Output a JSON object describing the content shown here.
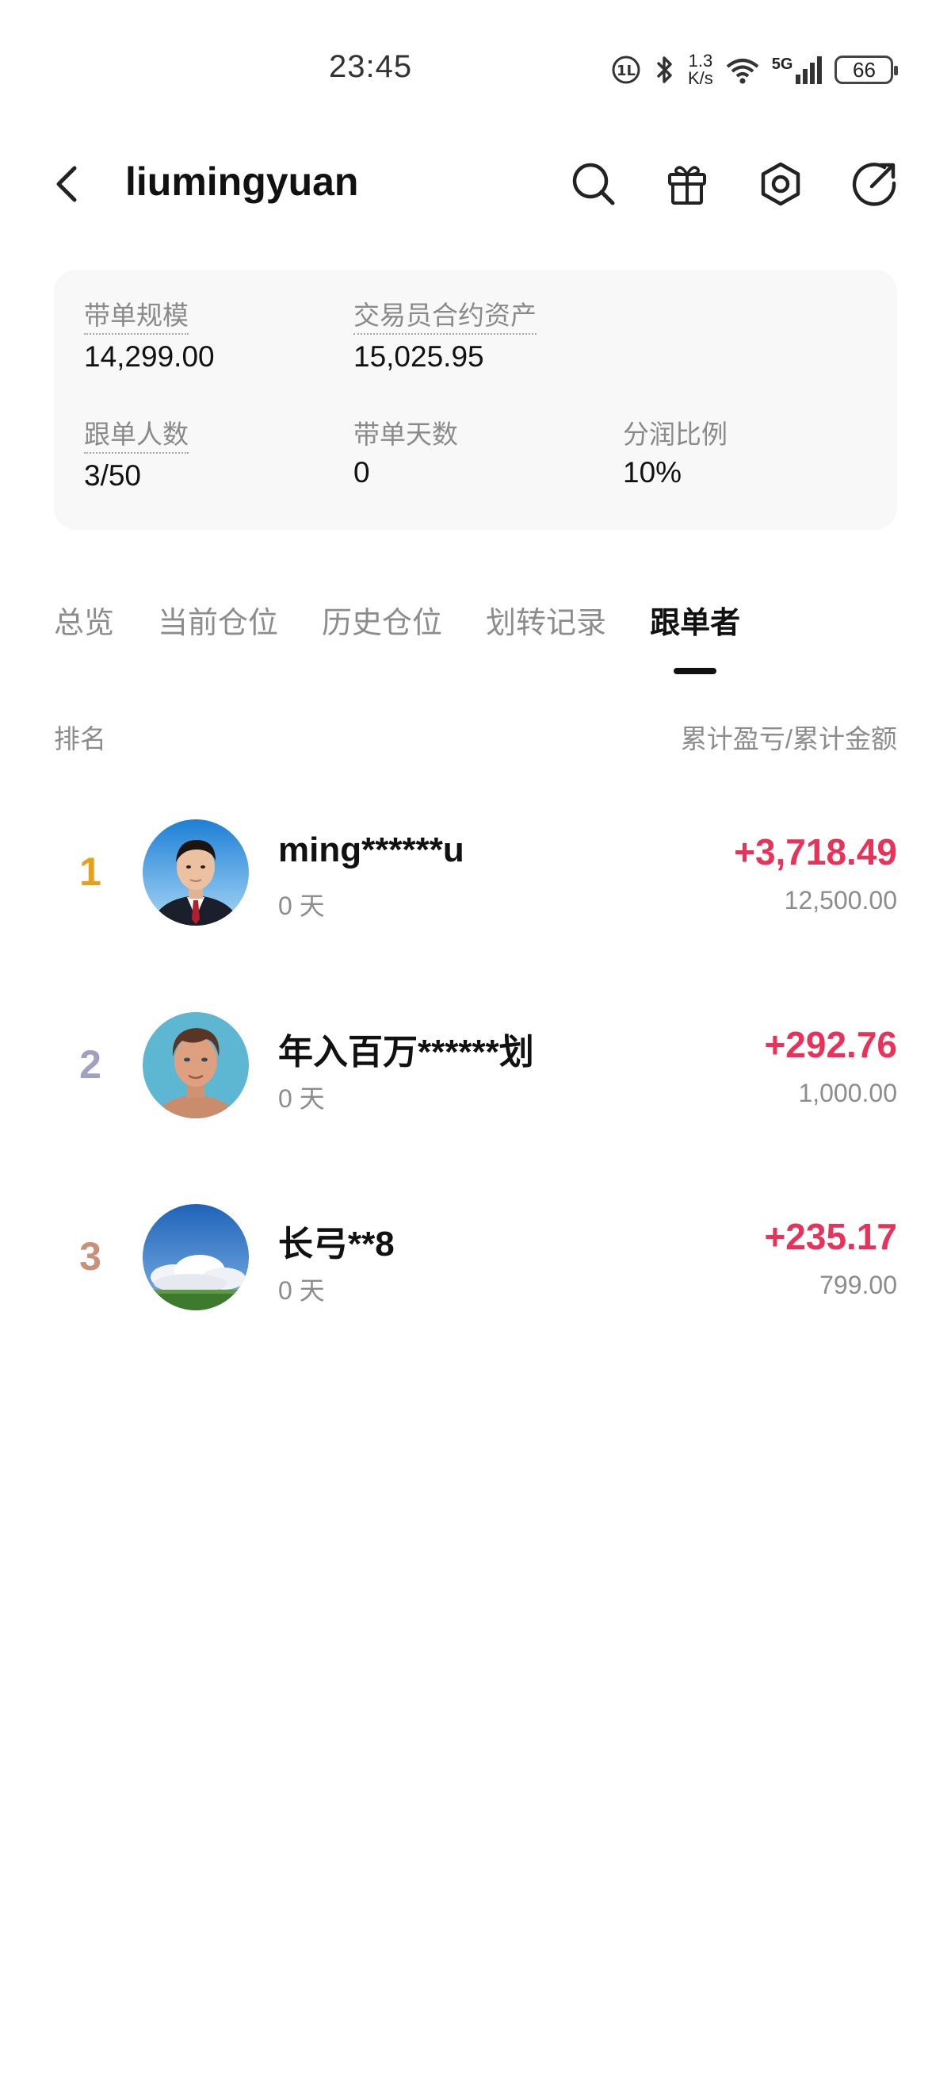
{
  "status_bar": {
    "time": "23:45",
    "net_speed_value": "1.3",
    "net_speed_unit": "K/s",
    "signal_label": "5G",
    "battery": "66"
  },
  "header": {
    "title": "liumingyuan",
    "icons": [
      "back-icon",
      "search-icon",
      "gift-icon",
      "settings-icon",
      "share-icon"
    ]
  },
  "stats": {
    "scale_label": "带单规模",
    "scale_value": "14,299.00",
    "assets_label": "交易员合约资产",
    "assets_value": "15,025.95",
    "followers_label": "跟单人数",
    "followers_value": "3/50",
    "days_label": "带单天数",
    "days_value": "0",
    "share_label": "分润比例",
    "share_value": "10%"
  },
  "tabs": [
    "总览",
    "当前仓位",
    "历史仓位",
    "划转记录",
    "跟单者"
  ],
  "active_tab": "跟单者",
  "list_header": {
    "rank": "排名",
    "value": "累计盈亏/累计金额"
  },
  "followers": [
    {
      "rank": "1",
      "name": "ming******u",
      "days": "0 天",
      "pnl": "+3,718.49",
      "amount": "12,500.00"
    },
    {
      "rank": "2",
      "name": "年入百万******划",
      "days": "0 天",
      "pnl": "+292.76",
      "amount": "1,000.00"
    },
    {
      "rank": "3",
      "name": "长弓**8",
      "days": "0 天",
      "pnl": "+235.17",
      "amount": "799.00"
    }
  ],
  "colors": {
    "profit": "#e8325a",
    "rank1": "#e6a11c",
    "rank2": "#9fa0c4",
    "rank3": "#c9917a"
  }
}
